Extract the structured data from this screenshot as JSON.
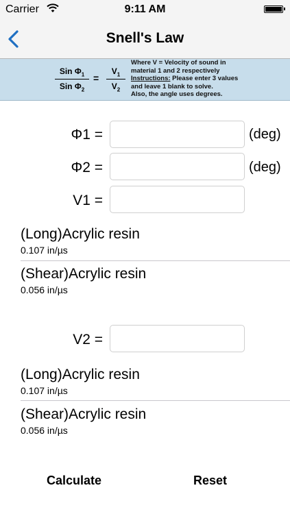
{
  "status_bar": {
    "carrier": "Carrier",
    "time": "9:11 AM",
    "wifi_icon": "wifi-icon",
    "battery_icon": "battery-full-icon"
  },
  "nav": {
    "title": "Snell's Law",
    "back_icon": "chevron-left-icon",
    "accent_color": "#1f6fc2"
  },
  "formula": {
    "frac1_num": "Sin Φ",
    "frac1_num_sub": "1",
    "frac1_den": "Sin Φ",
    "frac1_den_sub": "2",
    "equals": "=",
    "frac2_num": "V",
    "frac2_num_sub": "1",
    "frac2_den": "V",
    "frac2_den_sub": "2",
    "note_line1": "Where V = Velocity of sound in",
    "note_line2": "material 1 and 2 respectively",
    "note_instr_label": "Instructions:",
    "note_line3_rest": " Please enter 3 values",
    "note_line4": "and leave 1 blank to solve.",
    "note_line5": "Also, the angle uses degrees.",
    "background_color": "#c7ddeb"
  },
  "inputs": {
    "phi1_label": "Φ1 =",
    "phi1_value": "",
    "phi1_unit": "(deg)",
    "phi2_label": "Φ2 =",
    "phi2_value": "",
    "phi2_unit": "(deg)",
    "v1_label": "V1 =",
    "v1_value": "",
    "v2_label": "V2 =",
    "v2_value": ""
  },
  "materials_1": [
    {
      "name": "(Long)Acrylic resin",
      "speed": "0.107 in/µs"
    },
    {
      "name": "(Shear)Acrylic resin",
      "speed": "0.056 in/µs"
    }
  ],
  "materials_2": [
    {
      "name": "(Long)Acrylic resin",
      "speed": "0.107 in/µs"
    },
    {
      "name": "(Shear)Acrylic resin",
      "speed": "0.056 in/µs"
    }
  ],
  "buttons": {
    "calculate": "Calculate",
    "reset": "Reset"
  }
}
